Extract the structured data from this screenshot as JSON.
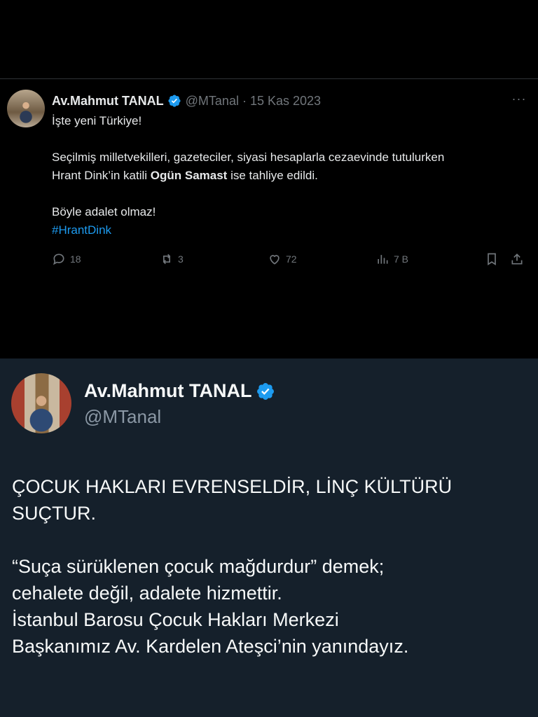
{
  "tweet": {
    "author": "Av.Mahmut TANAL",
    "handle": "@MTanal",
    "separator": "·",
    "date": "15 Kas 2023",
    "more": "···",
    "line1": "İşte yeni Türkiye!",
    "line2": "Seçilmiş milletvekilleri, gazeteciler, siyasi hesaplarla cezaevinde tutulurken",
    "line3_prefix": "Hrant Dink’in katili ",
    "line3_bold": "Ogün Samast",
    "line3_suffix": " ise tahliye edildi.",
    "line4": "Böyle adalet olmaz!",
    "hashtag": "#HrantDink",
    "actions": {
      "replies": "18",
      "reposts": "3",
      "likes": "72",
      "views": "7 B"
    }
  },
  "card": {
    "author": "Av.Mahmut TANAL",
    "handle": "@MTanal",
    "paragraph1_line1": "ÇOCUK HAKLARI EVRENSELDİR, LİNÇ KÜLTÜRÜ",
    "paragraph1_line2": "SUÇTUR.",
    "paragraph2_line1": "“Suça sürüklenen çocuk mağdurdur” demek;",
    "paragraph2_line2": "cehalete değil, adalete hizmettir.",
    "paragraph2_line3": "İstanbul Barosu Çocuk Hakları Merkezi",
    "paragraph2_line4": "Başkanımız Av. Kardelen Ateşci’nin yanındayız."
  },
  "colors": {
    "top_background": "#000000",
    "bottom_background": "#15202b",
    "accent": "#1d9bf0",
    "muted": "#71767b"
  },
  "icons": [
    "verified-badge-icon",
    "more-icon",
    "reply-icon",
    "repost-icon",
    "like-icon",
    "views-icon",
    "bookmark-icon",
    "share-icon"
  ]
}
